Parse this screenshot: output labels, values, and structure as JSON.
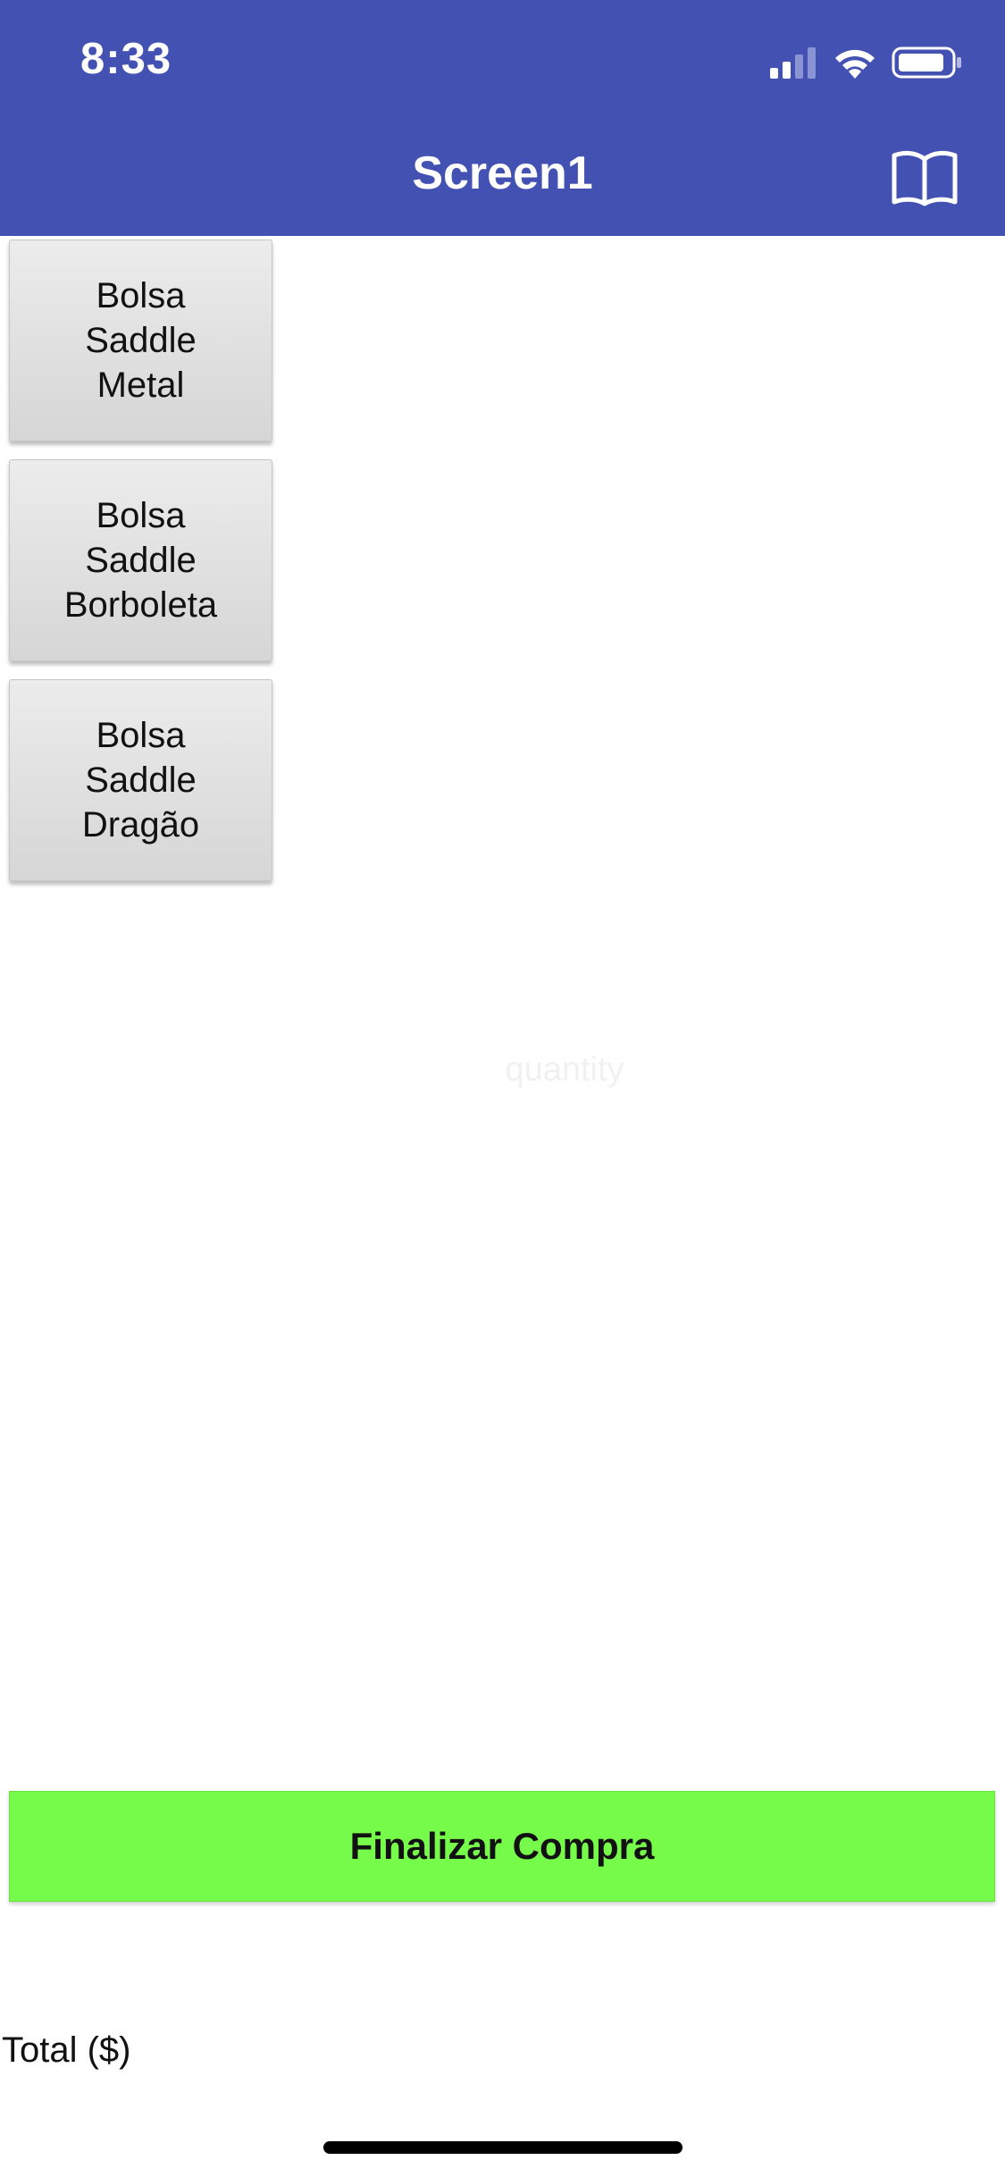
{
  "status_bar": {
    "time": "8:33"
  },
  "header": {
    "title": "Screen1",
    "background": "#4352b2",
    "right_icon": "book-icon"
  },
  "products": [
    {
      "label": "Bolsa Saddle Metal"
    },
    {
      "label": "Bolsa Saddle Borboleta"
    },
    {
      "label": "Bolsa Saddle Dragão"
    }
  ],
  "quantity": {
    "placeholder": "quantity",
    "value": ""
  },
  "checkout": {
    "label": "Finalizar Compra",
    "color": "#77fb4b"
  },
  "total": {
    "label": "Total ($)"
  }
}
